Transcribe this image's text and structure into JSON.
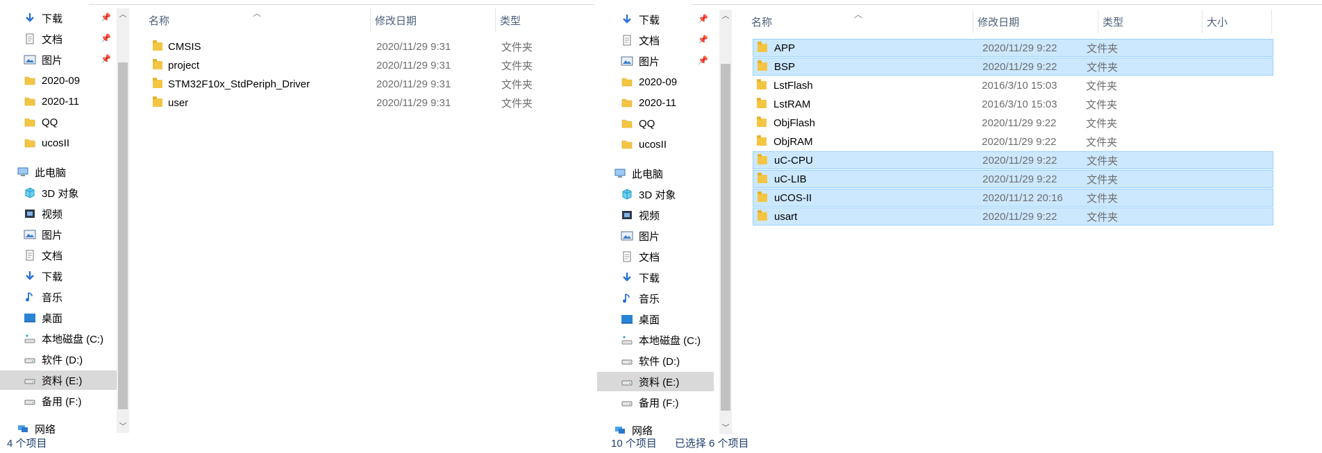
{
  "left": {
    "nav_items": [
      {
        "label": "下载",
        "icon": "download-arrow-icon",
        "pinned": true
      },
      {
        "label": "文档",
        "icon": "document-icon",
        "pinned": true
      },
      {
        "label": "图片",
        "icon": "picture-icon",
        "pinned": true
      },
      {
        "label": "2020-09",
        "icon": "folder-icon",
        "pinned": false
      },
      {
        "label": "2020-11",
        "icon": "folder-icon",
        "pinned": false
      },
      {
        "label": "QQ",
        "icon": "folder-icon",
        "pinned": false
      },
      {
        "label": "ucosII",
        "icon": "folder-icon",
        "pinned": false
      },
      {
        "label": "此电脑",
        "icon": "computer-icon",
        "pinned": false,
        "top": true
      },
      {
        "label": "3D 对象",
        "icon": "3d-objects-icon",
        "pinned": false
      },
      {
        "label": "视频",
        "icon": "video-icon",
        "pinned": false
      },
      {
        "label": "图片",
        "icon": "picture-icon",
        "pinned": false
      },
      {
        "label": "文档",
        "icon": "document-icon",
        "pinned": false
      },
      {
        "label": "下载",
        "icon": "download-arrow-icon",
        "pinned": false
      },
      {
        "label": "音乐",
        "icon": "music-note-icon",
        "pinned": false
      },
      {
        "label": "桌面",
        "icon": "desktop-icon",
        "pinned": false
      },
      {
        "label": "本地磁盘 (C:)",
        "icon": "system-drive-icon",
        "pinned": false
      },
      {
        "label": "软件 (D:)",
        "icon": "drive-icon",
        "pinned": false
      },
      {
        "label": "资料 (E:)",
        "icon": "drive-icon",
        "pinned": false,
        "selected": true
      },
      {
        "label": "备用 (F:)",
        "icon": "drive-icon",
        "pinned": false
      },
      {
        "label": "网络",
        "icon": "network-icon",
        "pinned": false,
        "top": true
      }
    ],
    "columns": {
      "name": "名称",
      "date": "修改日期",
      "type": "类型"
    },
    "files": [
      {
        "name": "CMSIS",
        "date": "2020/11/29 9:31",
        "type": "文件夹"
      },
      {
        "name": "project",
        "date": "2020/11/29 9:31",
        "type": "文件夹"
      },
      {
        "name": "STM32F10x_StdPeriph_Driver",
        "date": "2020/11/29 9:31",
        "type": "文件夹"
      },
      {
        "name": "user",
        "date": "2020/11/29 9:31",
        "type": "文件夹"
      }
    ],
    "status": {
      "count": "4 个项目"
    }
  },
  "right": {
    "nav_items": [
      {
        "label": "下载",
        "icon": "download-arrow-icon",
        "pinned": true
      },
      {
        "label": "文档",
        "icon": "document-icon",
        "pinned": true
      },
      {
        "label": "图片",
        "icon": "picture-icon",
        "pinned": true
      },
      {
        "label": "2020-09",
        "icon": "folder-icon",
        "pinned": false
      },
      {
        "label": "2020-11",
        "icon": "folder-icon",
        "pinned": false
      },
      {
        "label": "QQ",
        "icon": "folder-icon",
        "pinned": false
      },
      {
        "label": "ucosII",
        "icon": "folder-icon",
        "pinned": false
      },
      {
        "label": "此电脑",
        "icon": "computer-icon",
        "pinned": false,
        "top": true
      },
      {
        "label": "3D 对象",
        "icon": "3d-objects-icon",
        "pinned": false
      },
      {
        "label": "视频",
        "icon": "video-icon",
        "pinned": false
      },
      {
        "label": "图片",
        "icon": "picture-icon",
        "pinned": false
      },
      {
        "label": "文档",
        "icon": "document-icon",
        "pinned": false
      },
      {
        "label": "下载",
        "icon": "download-arrow-icon",
        "pinned": false
      },
      {
        "label": "音乐",
        "icon": "music-note-icon",
        "pinned": false
      },
      {
        "label": "桌面",
        "icon": "desktop-icon",
        "pinned": false
      },
      {
        "label": "本地磁盘 (C:)",
        "icon": "system-drive-icon",
        "pinned": false
      },
      {
        "label": "软件 (D:)",
        "icon": "drive-icon",
        "pinned": false
      },
      {
        "label": "资料 (E:)",
        "icon": "drive-icon",
        "pinned": false,
        "selected": true
      },
      {
        "label": "备用 (F:)",
        "icon": "drive-icon",
        "pinned": false
      },
      {
        "label": "网络",
        "icon": "network-icon",
        "pinned": false,
        "top": true
      }
    ],
    "columns": {
      "name": "名称",
      "date": "修改日期",
      "type": "类型",
      "size": "大小"
    },
    "files": [
      {
        "name": "APP",
        "date": "2020/11/29 9:22",
        "type": "文件夹",
        "selected": true
      },
      {
        "name": "BSP",
        "date": "2020/11/29 9:22",
        "type": "文件夹",
        "selected": true
      },
      {
        "name": "LstFlash",
        "date": "2016/3/10 15:03",
        "type": "文件夹",
        "selected": false
      },
      {
        "name": "LstRAM",
        "date": "2016/3/10 15:03",
        "type": "文件夹",
        "selected": false
      },
      {
        "name": "ObjFlash",
        "date": "2020/11/29 9:22",
        "type": "文件夹",
        "selected": false
      },
      {
        "name": "ObjRAM",
        "date": "2020/11/29 9:22",
        "type": "文件夹",
        "selected": false
      },
      {
        "name": "uC-CPU",
        "date": "2020/11/29 9:22",
        "type": "文件夹",
        "selected": true
      },
      {
        "name": "uC-LIB",
        "date": "2020/11/29 9:22",
        "type": "文件夹",
        "selected": true
      },
      {
        "name": "uCOS-II",
        "date": "2020/11/12 20:16",
        "type": "文件夹",
        "selected": true
      },
      {
        "name": "usart",
        "date": "2020/11/29 9:22",
        "type": "文件夹",
        "selected": true
      }
    ],
    "status": {
      "count": "10 个项目",
      "selected": "已选择 6 个项目"
    }
  },
  "colors": {
    "selection": "#cce8ff",
    "selection_border": "#99d1ff",
    "nav_selected": "#d9d9d9",
    "header_text": "#4c607a",
    "muted_text": "#6d6d6d"
  }
}
